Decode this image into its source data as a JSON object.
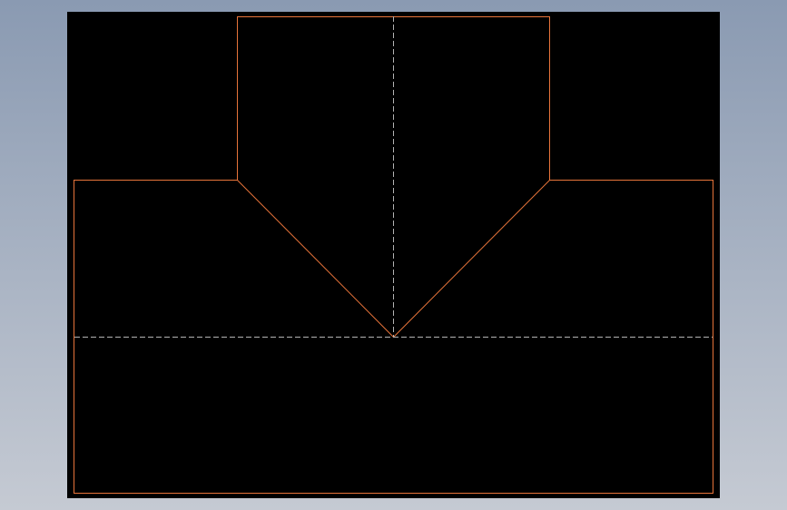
{
  "viewport": {
    "background_top": "#8a9ab2",
    "background_bottom": "#c5cad3"
  },
  "canvas": {
    "background": "#000000"
  },
  "drawing": {
    "outline_color": "#e8743a",
    "centerline_color": "#b4b4b4"
  }
}
